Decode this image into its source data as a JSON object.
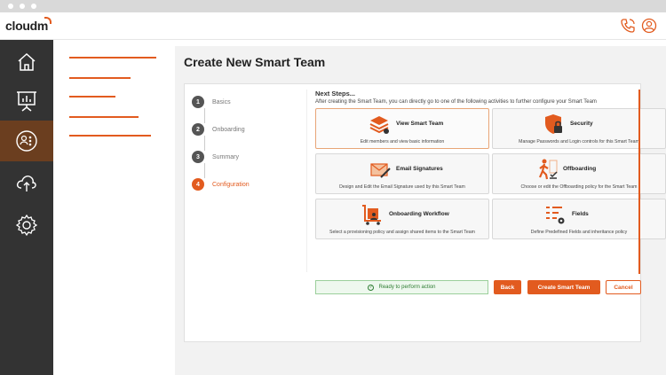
{
  "app": {
    "logo_text": "cloudm"
  },
  "colors": {
    "accent": "#e25b1f",
    "sidebar": "#333333",
    "sidebar_active": "#6b3e1f",
    "success": "#2e7d32"
  },
  "header": {
    "icons": [
      "phone-icon",
      "user-icon"
    ]
  },
  "sidebar": {
    "items": [
      {
        "name": "home-icon"
      },
      {
        "name": "presentation-icon"
      },
      {
        "name": "team-icon",
        "active": true
      },
      {
        "name": "cloud-upload-icon"
      },
      {
        "name": "gear-icon"
      }
    ]
  },
  "page": {
    "title": "Create New Smart Team"
  },
  "steps": [
    {
      "num": "1",
      "label": "Basics"
    },
    {
      "num": "2",
      "label": "Onboarding"
    },
    {
      "num": "3",
      "label": "Summary"
    },
    {
      "num": "4",
      "label": "Configuration",
      "active": true
    }
  ],
  "next": {
    "title": "Next Steps...",
    "description": "After creating the Smart Team, you can directly go to one of the following activities to further configure your Smart Team"
  },
  "tiles": [
    {
      "name": "View Smart Team",
      "desc": "Edit members and view basic information",
      "icon": "layers-icon"
    },
    {
      "name": "Security",
      "desc": "Manage Passwords and Login controls for this Smart Team",
      "icon": "shield-lock-icon"
    },
    {
      "name": "Email Signatures",
      "desc": "Design and Edit the Email Signature used by this Smart Team",
      "icon": "envelope-pen-icon"
    },
    {
      "name": "Offboarding",
      "desc": "Choose or edit the Offboarding policy for the Smart Team",
      "icon": "walking-person-icon"
    },
    {
      "name": "Onboarding Workflow",
      "desc": "Select a provisioning policy and assign shared items to the Smart Team",
      "icon": "luggage-cart-icon"
    },
    {
      "name": "Fields",
      "desc": "Define Predefined Fields and inheritance policy",
      "icon": "list-gear-icon"
    }
  ],
  "footer": {
    "status": "Ready to perform action",
    "back": "Back",
    "create": "Create Smart Team",
    "cancel": "Cancel"
  }
}
